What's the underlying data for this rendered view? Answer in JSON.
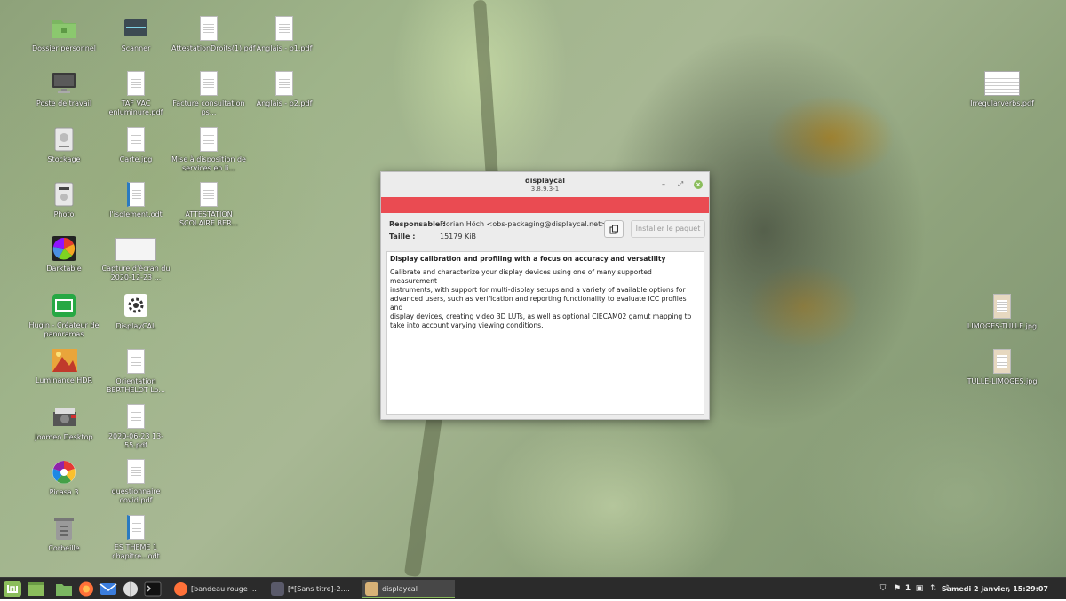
{
  "desktop_icons": [
    {
      "label": "Dossier personnel",
      "icon": "folder-home-icon"
    },
    {
      "label": "Poste de travail",
      "icon": "computer-icon"
    },
    {
      "label": "Stockage",
      "icon": "drive-icon"
    },
    {
      "label": "Photo",
      "icon": "drive-icon"
    },
    {
      "label": "Darktable",
      "icon": "darktable-icon"
    },
    {
      "label": "Hugin - Créateur de panoramas",
      "icon": "hugin-icon"
    },
    {
      "label": "Luminance HDR",
      "icon": "luminance-icon"
    },
    {
      "label": "Joomeo Desktop",
      "icon": "joomeo-icon"
    },
    {
      "label": "Picasa 3",
      "icon": "picasa-icon"
    },
    {
      "label": "Corbeille",
      "icon": "trash-icon"
    },
    {
      "label": "Scanner",
      "icon": "scanner-icon"
    },
    {
      "label": "TAF VAC enluminure.pdf",
      "icon": "pdf-icon"
    },
    {
      "label": "Carte.jpg",
      "icon": "image-icon"
    },
    {
      "label": "l'isolement.odt",
      "icon": "odt-icon"
    },
    {
      "label": "Capture d'écran du 2020-12-23 ...",
      "icon": "screenshot-icon"
    },
    {
      "label": "DisplayCAL",
      "icon": "gear-icon"
    },
    {
      "label": "Orientation BERTHELOT Lo...",
      "icon": "pdf-icon"
    },
    {
      "label": "2020-06-23 13-55.pdf",
      "icon": "pdf-icon"
    },
    {
      "label": "questionnaire covid.pdf",
      "icon": "pdf-icon"
    },
    {
      "label": "ES THEME 1 chapitre...odt",
      "icon": "odt-icon"
    },
    {
      "label": "AttestationDroits(1).pdf",
      "icon": "pdf-icon"
    },
    {
      "label": "Facture consultation ps...",
      "icon": "pdf-icon"
    },
    {
      "label": "Mise à disposition de services en li...",
      "icon": "pdf-icon"
    },
    {
      "label": "ATTESTATION SCOLAIRE BER...",
      "icon": "pdf-icon"
    },
    {
      "label": "Anglais - p1.pdf",
      "icon": "pdf-icon"
    },
    {
      "label": "Anglais - p2.pdf",
      "icon": "pdf-icon"
    },
    {
      "label": "Irregularverbs.pdf",
      "icon": "pdf-icon"
    },
    {
      "label": "LIMOGES-TULLE.jpg",
      "icon": "image-icon"
    },
    {
      "label": "TULLE-LIMOGES.jpg",
      "icon": "image-icon"
    }
  ],
  "dialog": {
    "title": "displaycal",
    "version": "3.8.9.3-1",
    "accent_color": "#ea4b52",
    "maintainer_label": "Responsable :",
    "maintainer_value": "Florian Höch <obs-packaging@displaycal.net>",
    "size_label": "Taille :",
    "size_value": "15179 KiB",
    "install_button": "Installer le paquet",
    "description_title": "Display calibration and profiling with a focus on accuracy and versatility",
    "description_lines": [
      "Calibrate and characterize your display devices using one of many supported measurement",
      "instruments, with support for multi-display setups and a variety of available options for",
      "advanced users, such as verification and reporting functionality to evaluate ICC profiles and",
      "display devices, creating video 3D LUTs, as well as optional CIECAM02 gamut mapping to",
      "take into account varying viewing conditions."
    ]
  },
  "taskbar": {
    "tasks": [
      {
        "label": "[bandeau rouge ...",
        "icon": "firefox-icon"
      },
      {
        "label": "[*[Sans titre]-2....",
        "icon": "gimp-icon"
      },
      {
        "label": "displaycal",
        "icon": "package-icon",
        "active": true
      }
    ],
    "tray_count": "1",
    "clock": "Samedi  2 janvier, 15:29:07"
  }
}
